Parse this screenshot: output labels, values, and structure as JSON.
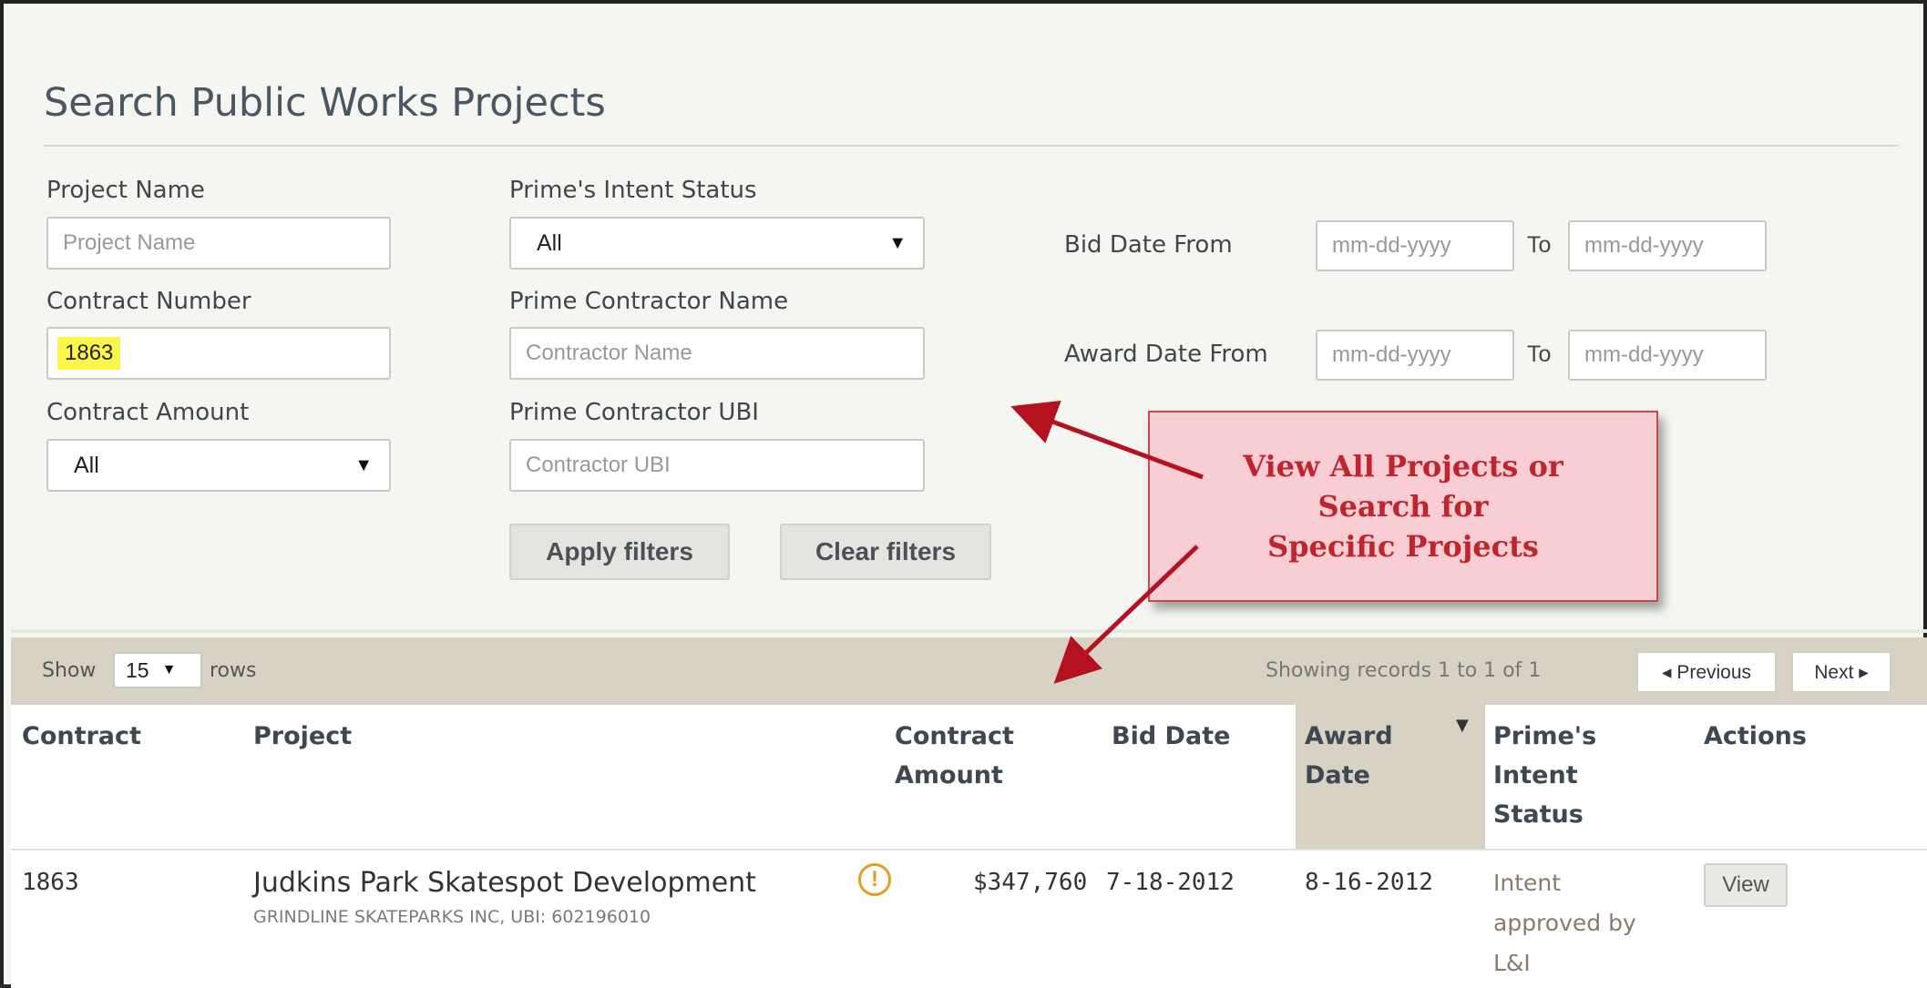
{
  "page": {
    "title": "Search Public Works Projects"
  },
  "filters": {
    "project_name": {
      "label": "Project Name",
      "placeholder": "Project Name"
    },
    "contract_number": {
      "label": "Contract Number",
      "value": "1863"
    },
    "contract_amount": {
      "label": "Contract Amount",
      "selected": "All"
    },
    "intent_status": {
      "label": "Prime's Intent Status",
      "selected": "All"
    },
    "contractor_name": {
      "label": "Prime Contractor Name",
      "placeholder": "Contractor Name"
    },
    "contractor_ubi": {
      "label": "Prime Contractor UBI",
      "placeholder": "Contractor UBI"
    },
    "bid_date": {
      "label": "Bid Date From",
      "from_placeholder": "mm-dd-yyyy",
      "to_label": "To",
      "to_placeholder": "mm-dd-yyyy"
    },
    "award_date": {
      "label": "Award Date From",
      "from_placeholder": "mm-dd-yyyy",
      "to_label": "To",
      "to_placeholder": "mm-dd-yyyy"
    },
    "apply_label": "Apply filters",
    "clear_label": "Clear filters"
  },
  "callout": {
    "lines": [
      "View All Projects or",
      "Search for",
      "Specific Projects"
    ],
    "color": "#c0242d"
  },
  "toolbar": {
    "show_label": "Show",
    "rows_value": "15",
    "rows_label": "rows",
    "records_text": "Showing records 1 to 1 of 1",
    "prev_label": "◂ Previous",
    "next_label": "Next ▸"
  },
  "table": {
    "headers": {
      "contract": "Contract",
      "project": "Project",
      "amount": [
        "Contract",
        "Amount"
      ],
      "bid_date": "Bid Date",
      "award_date": [
        "Award",
        "Date"
      ],
      "intent": [
        "Prime's",
        "Intent",
        "Status"
      ],
      "actions": "Actions"
    },
    "rows": [
      {
        "contract": "1863",
        "project": "Judkins Park Skatespot Development",
        "contractor": "GRINDLINE SKATEPARKS INC, UBI: 602196010",
        "warning_icon": "!",
        "amount": "$347,760",
        "bid_date": "7-18-2012",
        "award_date": "8-16-2012",
        "intent_status": [
          "Intent",
          "approved by",
          "L&I"
        ],
        "action_label": "View"
      }
    ]
  }
}
